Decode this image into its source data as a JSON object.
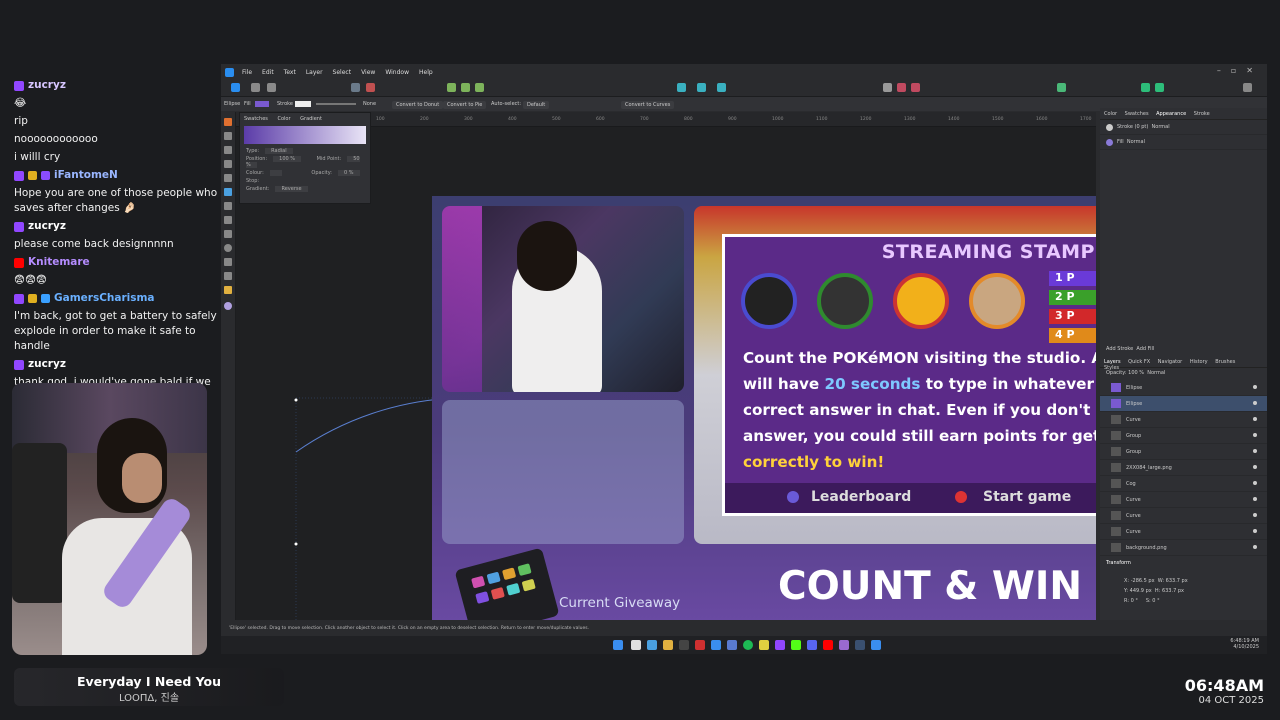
{
  "chat": [
    {
      "type": "user",
      "platform": "twitch",
      "name": "zucryz",
      "color": "#d7c6ff",
      "badges": []
    },
    {
      "type": "text",
      "text": "😂"
    },
    {
      "type": "text",
      "text": "rip"
    },
    {
      "type": "text",
      "text": "noooooooooooo"
    },
    {
      "type": "text",
      "text": "i willl cry"
    },
    {
      "type": "user",
      "platform": "twitch",
      "name": "iFantomeN",
      "color": "#9ab6ff",
      "badges": [
        "#e0b020",
        "#8a4cff"
      ]
    },
    {
      "type": "text",
      "text": "Hope you are one of those people who saves after changes 🤌🏻"
    },
    {
      "type": "user",
      "platform": "twitch",
      "name": "zucryz",
      "color": "#ffffff",
      "badges": []
    },
    {
      "type": "text",
      "text": "please come back designnnnn"
    },
    {
      "type": "user",
      "platform": "youtube",
      "name": "Knitemare",
      "color": "#b58cff",
      "badges": []
    },
    {
      "type": "text",
      "text": "😨😨😨"
    },
    {
      "type": "user",
      "platform": "twitch",
      "name": "GamersCharisma",
      "color": "#6ab0ff",
      "badges": [
        "#e0b020",
        "#3aa0ff"
      ]
    },
    {
      "type": "text",
      "text": "I'm back, got to get a battery to safely explode in order to make it safe to handle"
    },
    {
      "type": "user",
      "platform": "twitch",
      "name": "zucryz",
      "color": "#ffffff",
      "badges": []
    },
    {
      "type": "text",
      "text": "thank god. i would've gone bald if we lost that"
    }
  ],
  "now_playing": {
    "title": "Everyday I Need You",
    "artist": "LOOΠΔ, 진솔"
  },
  "clock": {
    "time": "06:48AM",
    "date": "04 OCT 2025"
  },
  "app": {
    "menu": [
      "File",
      "Edit",
      "Text",
      "Layer",
      "Select",
      "View",
      "Window",
      "Help"
    ],
    "context": {
      "shape": "Ellipse",
      "fill": "Fill",
      "stroke": "Stroke",
      "stroke_style": "None",
      "convert_donut": "Convert to Donut",
      "convert_pie": "Convert to Pie",
      "auto_select": "Auto-select:",
      "auto_select_value": "Default",
      "convert_curves": "Convert to Curves"
    },
    "swatch_panel": {
      "tabs": [
        "Swatches",
        "Color",
        "Gradient"
      ],
      "type_label": "Type:",
      "type_value": "Radial",
      "position_label": "Position:",
      "position_value": "100 %",
      "midpoint_label": "Mid Point:",
      "midpoint_value": "50 %",
      "colour_label": "Colour:",
      "opacity_label": "Opacity:",
      "opacity_value": "0 %",
      "stop_label": "Stop:",
      "gradient_label": "Gradient:",
      "reverse": "Reverse"
    },
    "ruler": [
      "100",
      "200",
      "300",
      "400",
      "500",
      "600",
      "700",
      "800",
      "900",
      "1000",
      "1100",
      "1200",
      "1300",
      "1400",
      "1500",
      "1600",
      "1700",
      "1800"
    ],
    "status": "'Ellipse' selected. Drag to move selection. Click another object to select it. Click on an empty area to deselect selection. Return to enter move/duplicate values.",
    "right_panel": {
      "tabs": [
        "Color",
        "Swatches",
        "Appearance",
        "Stroke"
      ],
      "appearance_rows": [
        {
          "label": "Stroke (0 pt)",
          "mode": "Normal"
        },
        {
          "label": "Fill",
          "mode": "Normal"
        }
      ],
      "add_stroke": "Add Stroke",
      "add_fill": "Add Fill",
      "layer_tabs": [
        "Layers",
        "Quick FX",
        "Navigator",
        "History",
        "Brushes",
        "Styles"
      ],
      "opacity_label": "Opacity:",
      "opacity_value": "100 %",
      "blend": "Normal",
      "layers": [
        "Ellipse",
        "Ellipse",
        "Curve",
        "Group",
        "Group",
        "2XX084_large.png",
        "Cog",
        "Curve",
        "Curve",
        "Curve",
        "background.png"
      ],
      "transform_tab": "Transform",
      "transform": {
        "x": "-286.5 px",
        "y": "449.9 px",
        "w": "633.7 px",
        "h": "633.7 px",
        "r": "0 °",
        "s": "0 °"
      }
    },
    "taskbar_time": {
      "time": "6:48:19 AM",
      "date": "4/10/2025"
    }
  },
  "artboard": {
    "stamp_title": "STREAMING STAMP",
    "places": [
      "1 P",
      "2 P",
      "3 P",
      "4 P"
    ],
    "body_line1": "Count the POKéMON visiting the studio. A",
    "body_line2_pre": "will have ",
    "body_line2_hl": "20 seconds",
    "body_line2_post": " to type in whatever",
    "body_line3": "correct answer in chat. Even if you don't g",
    "body_line4": "answer, you could still earn points for gett",
    "body_line5": "correctly to win!",
    "leaderboard": "Leaderboard",
    "start_game": "Start game",
    "count_win": "COUNT & WIN",
    "giveaway": "Current Giveaway"
  }
}
